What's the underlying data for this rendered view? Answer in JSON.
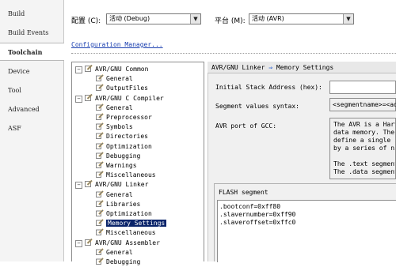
{
  "tabs": [
    "Build",
    "Build Events",
    "Toolchain",
    "Device",
    "Tool",
    "Advanced",
    "ASF"
  ],
  "active_tab": "Toolchain",
  "config": {
    "label": "配置 (C):",
    "value": "活动 (Debug)",
    "platform_label": "平台 (M):",
    "platform_value": "活动 (AVR)"
  },
  "config_manager_link": "Configuration Manager...",
  "tree": {
    "groups": [
      {
        "label": "AVR/GNU Common",
        "items": [
          "General",
          "OutputFiles"
        ]
      },
      {
        "label": "AVR/GNU C Compiler",
        "items": [
          "General",
          "Preprocessor",
          "Symbols",
          "Directories",
          "Optimization",
          "Debugging",
          "Warnings",
          "Miscellaneous"
        ]
      },
      {
        "label": "AVR/GNU Linker",
        "items": [
          "General",
          "Libraries",
          "Optimization",
          "Memory Settings",
          "Miscellaneous"
        ]
      },
      {
        "label": "AVR/GNU Assembler",
        "items": [
          "General",
          "Debugging"
        ]
      }
    ],
    "selected": "Memory Settings"
  },
  "panel": {
    "breadcrumb_parent": "AVR/GNU Linker",
    "breadcrumb_arrow": "⇒",
    "breadcrumb_current": "Memory Settings",
    "stack_label": "Initial Stack Address (hex):",
    "stack_value": "",
    "segment_syntax_label": "Segment values syntax:",
    "segment_syntax_value": "<segmentname>=<add",
    "avr_port_label": "AVR port of GCC:",
    "avr_port_text": [
      "The AVR is a Harva",
      "data memory. The g",
      "define a single st",
      "by a series of nif",
      "",
      "The .text segment",
      "The .data segment"
    ],
    "flash_title": "FLASH segment",
    "flash_lines": [
      ".bootconf=0xff80",
      ".slavernumber=0xff90",
      ".slaveroffset=0xffc0"
    ]
  },
  "colors": {
    "selection": "#0a246a",
    "link": "#1a3fb0",
    "arrow": "#2a5fd0"
  }
}
